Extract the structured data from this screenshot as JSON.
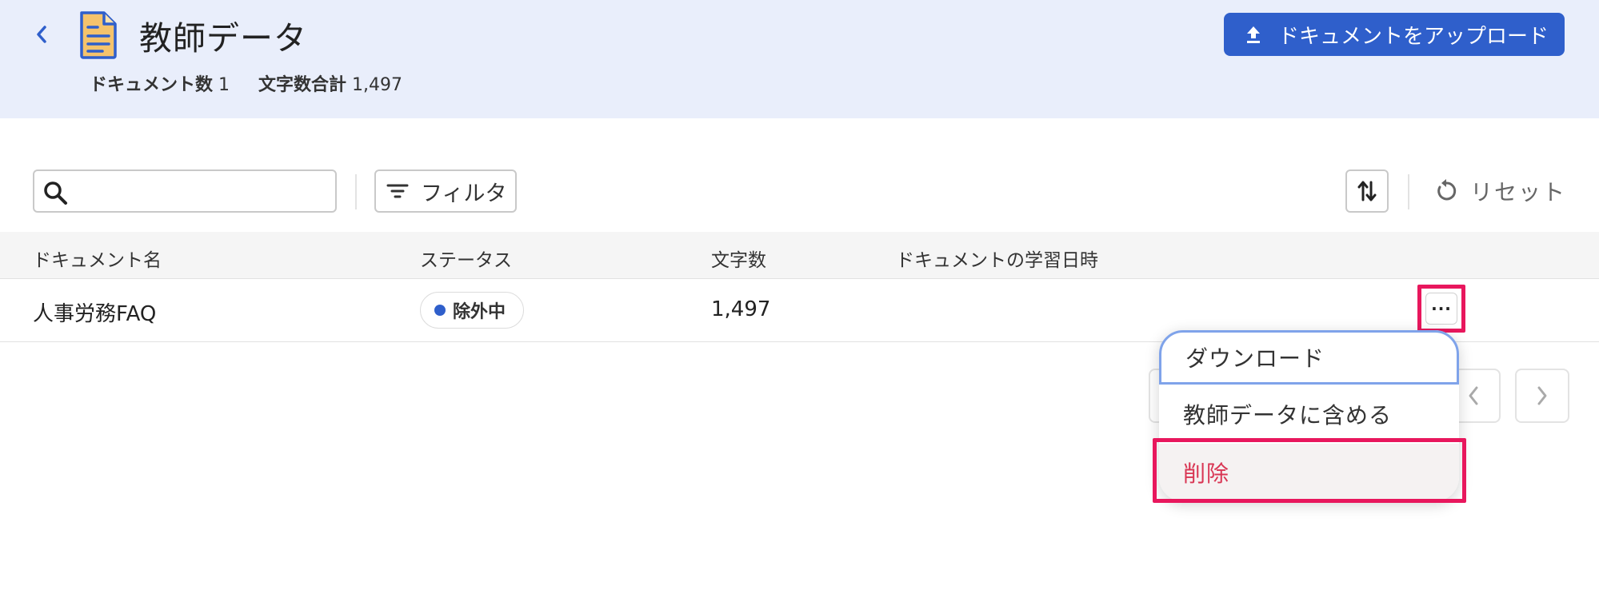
{
  "header": {
    "title": "教師データ",
    "stats": {
      "doc_count_label": "ドキュメント数",
      "doc_count_value": "1",
      "char_total_label": "文字数合計",
      "char_total_value": "1,497"
    },
    "upload_label": "ドキュメントをアップロード",
    "back_icon": "chevron-left-icon",
    "doc_icon": "document-icon"
  },
  "toolbar": {
    "search_value": "",
    "filter_label": "フィルタ",
    "reset_label": "リセット"
  },
  "table": {
    "columns": [
      "ドキュメント名",
      "ステータス",
      "文字数",
      "ドキュメントの学習日時"
    ],
    "rows": [
      {
        "name": "人事労務FAQ",
        "status": "除外中",
        "chars": "1,497",
        "learned_at": ""
      }
    ]
  },
  "menu": {
    "items": [
      "ダウンロード",
      "教師データに含める",
      "削除"
    ]
  },
  "colors": {
    "accent": "#2f5fcb",
    "header_bg": "#e9eefb",
    "highlight": "#e8175d",
    "danger": "#d93654"
  }
}
